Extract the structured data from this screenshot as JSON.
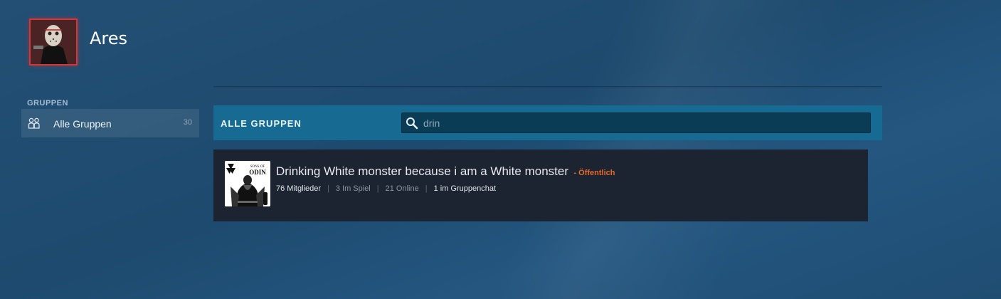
{
  "profile": {
    "name": "Ares"
  },
  "sidebar": {
    "heading": "GRUPPEN",
    "items": [
      {
        "label": "Alle Gruppen",
        "count": "30",
        "icon": "people-icon"
      }
    ]
  },
  "groups_panel": {
    "title": "ALLE GRUPPEN",
    "search": {
      "value": "drin",
      "icon": "search-icon"
    }
  },
  "groups": [
    {
      "name": "Drinking White monster because i am a White monster",
      "visibility": "- Öffentlich",
      "members": "76 Mitglieder",
      "in_game": "3 Im Spiel",
      "online": "21 Online",
      "in_chat": "1 im Gruppenchat",
      "avatar_text": {
        "top": "SONS OF",
        "bottom": "ODIN"
      }
    }
  ],
  "colors": {
    "accent_bar": "#176b93",
    "avatar_border": "#d0383a",
    "visibility": "#e26a2c",
    "card_bg": "#1c2431"
  }
}
